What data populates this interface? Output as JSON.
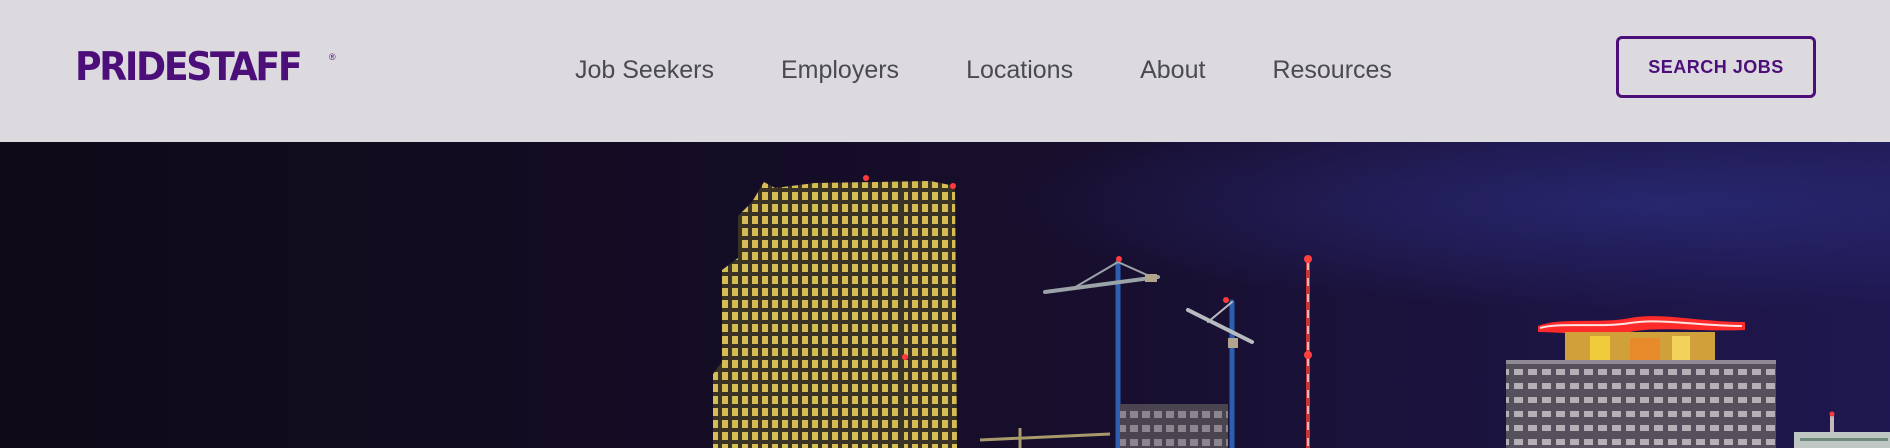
{
  "brand": {
    "name": "PRIDESTAFF",
    "registered_mark": "®",
    "color": "#4c0f7a"
  },
  "nav": {
    "items": [
      {
        "label": "Job Seekers"
      },
      {
        "label": "Employers"
      },
      {
        "label": "Locations"
      },
      {
        "label": "About"
      },
      {
        "label": "Resources"
      }
    ]
  },
  "cta": {
    "label": "SEARCH JOBS"
  },
  "hero": {
    "image": "night-city-skyline"
  },
  "colors": {
    "header_bg": "#dcdadf",
    "nav_text": "#4a4a4f",
    "accent": "#4c0f7a",
    "hero_sky": "#130c24"
  }
}
